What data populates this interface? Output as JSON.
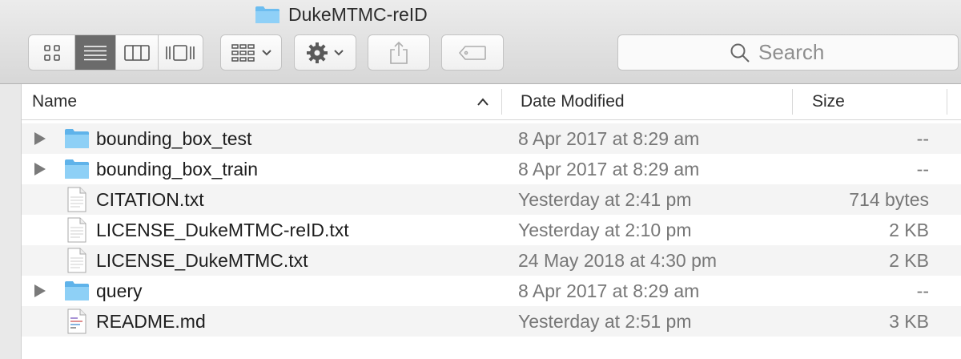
{
  "window": {
    "title": "DukeMTMC-reID",
    "title_icon": "folder-icon"
  },
  "toolbar": {
    "view_modes": [
      "icon-view",
      "list-view",
      "column-view",
      "cover-flow-view"
    ],
    "active_view": "list-view",
    "search_placeholder": "Search"
  },
  "columns": {
    "name": "Name",
    "date": "Date Modified",
    "size": "Size",
    "sort": "ascending"
  },
  "files": [
    {
      "name": "bounding_box_test",
      "date": "8 Apr 2017 at 8:29 am",
      "size": "--",
      "kind": "folder"
    },
    {
      "name": "bounding_box_train",
      "date": "8 Apr 2017 at 8:29 am",
      "size": "--",
      "kind": "folder"
    },
    {
      "name": "CITATION.txt",
      "date": "Yesterday at 2:41 pm",
      "size": "714 bytes",
      "kind": "text"
    },
    {
      "name": "LICENSE_DukeMTMC-reID.txt",
      "date": "Yesterday at 2:10 pm",
      "size": "2 KB",
      "kind": "text"
    },
    {
      "name": "LICENSE_DukeMTMC.txt",
      "date": "24 May 2018 at 4:30 pm",
      "size": "2 KB",
      "kind": "text"
    },
    {
      "name": "query",
      "date": "8 Apr 2017 at 8:29 am",
      "size": "--",
      "kind": "folder"
    },
    {
      "name": "README.md",
      "date": "Yesterday at 2:51 pm",
      "size": "3 KB",
      "kind": "markdown"
    }
  ],
  "colors": {
    "folder": "#7ec8f2",
    "active_segment": "#6b6b6b",
    "row_alt": "#f4f4f4"
  }
}
